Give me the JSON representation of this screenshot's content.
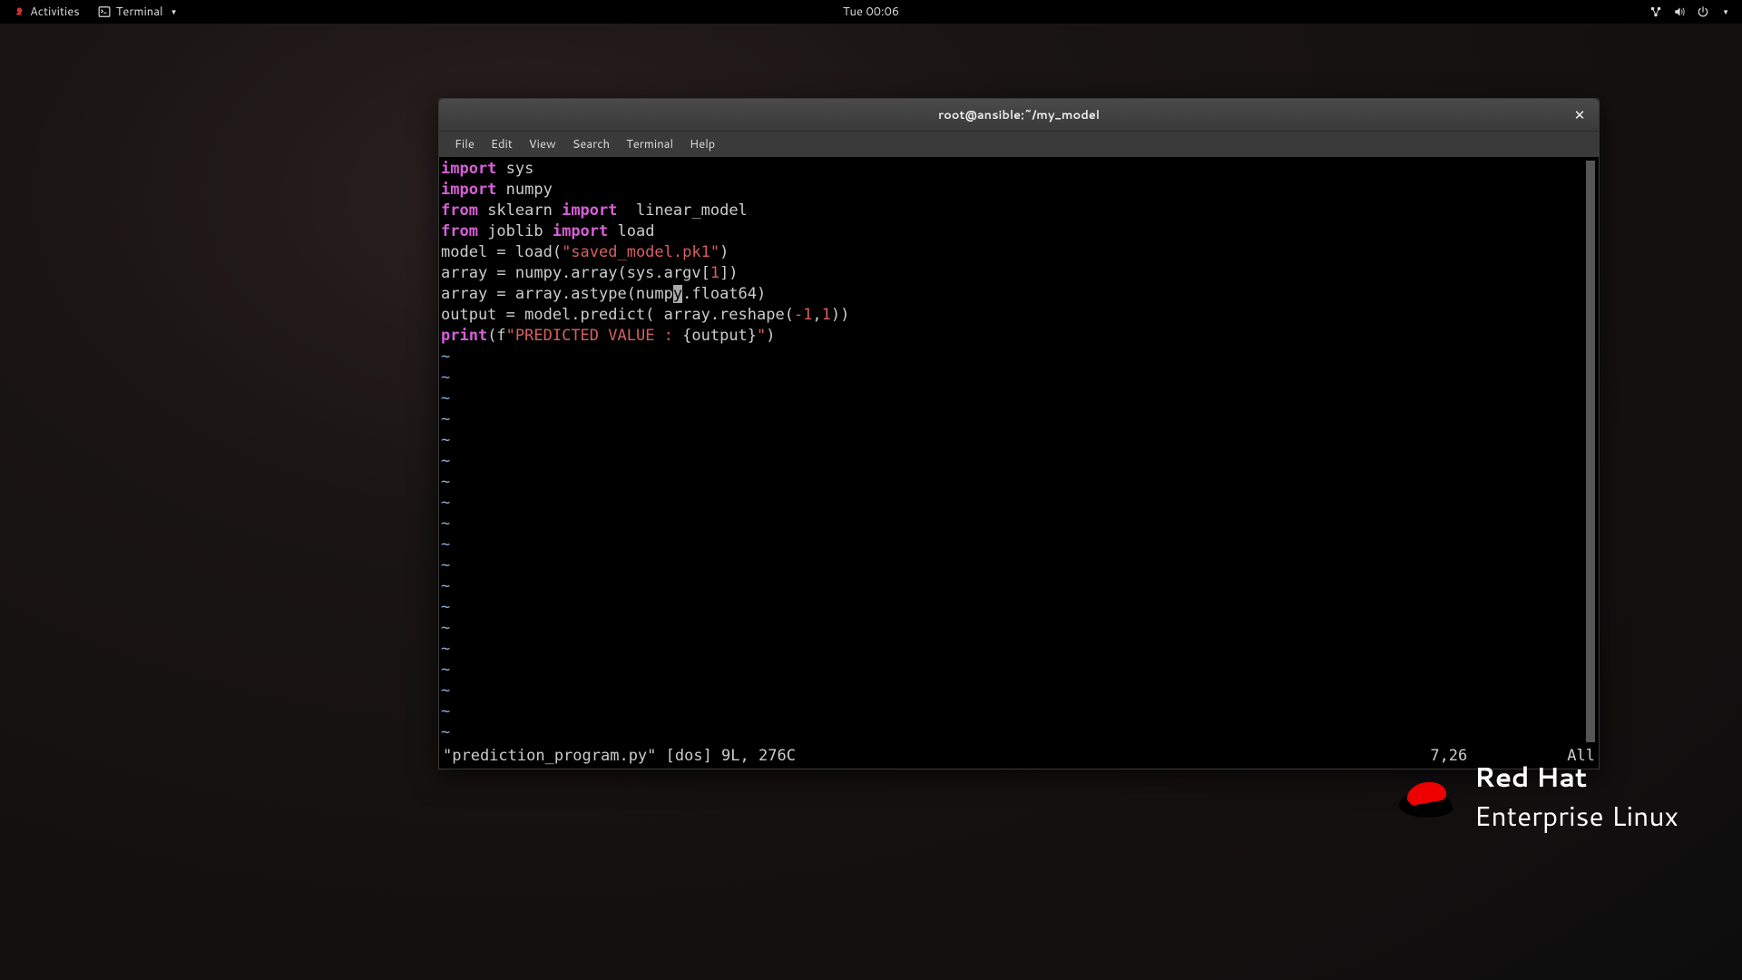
{
  "topbar": {
    "activities": "Activities",
    "app": "Terminal",
    "clock": "Tue 00:06"
  },
  "window": {
    "title": "root@ansible:~/my_model",
    "menu": [
      "File",
      "Edit",
      "View",
      "Search",
      "Terminal",
      "Help"
    ]
  },
  "vim": {
    "status_file": "\"prediction_program.py\" [dos] 9L, 276C",
    "status_pos": "7,26",
    "status_view": "All",
    "code": {
      "l1_kw": "import",
      "l1_rest": " sys",
      "l2_kw": "import",
      "l2_rest": " numpy",
      "l3_kw1": "from",
      "l3_mid1": " sklearn ",
      "l3_kw2": "import",
      "l3_mid2": "  linear_model",
      "l4_kw1": "from",
      "l4_mid1": " joblib ",
      "l4_kw2": "import",
      "l4_mid2": " load",
      "l5_a": "model = load(",
      "l5_str": "\"saved_model.pk1\"",
      "l5_b": ")",
      "l6_a": "array = numpy.array(sys.argv[",
      "l6_num": "1",
      "l6_b": "])",
      "l7_a": "array = array.astype(nump",
      "l7_cur": "y",
      "l7_b": ".float64)",
      "l8_a": "output = model.predict( array.reshape(",
      "l8_n1": "-1",
      "l8_m": ",",
      "l8_n2": "1",
      "l8_b": "))",
      "l9_kw": "print",
      "l9_a": "(f",
      "l9_s1": "\"PREDICTED VALUE : ",
      "l9_s2": "{output}",
      "l9_s3": "\"",
      "l9_b": ")"
    }
  },
  "branding": {
    "line1": "Red Hat",
    "line2": "Enterprise Linux"
  }
}
